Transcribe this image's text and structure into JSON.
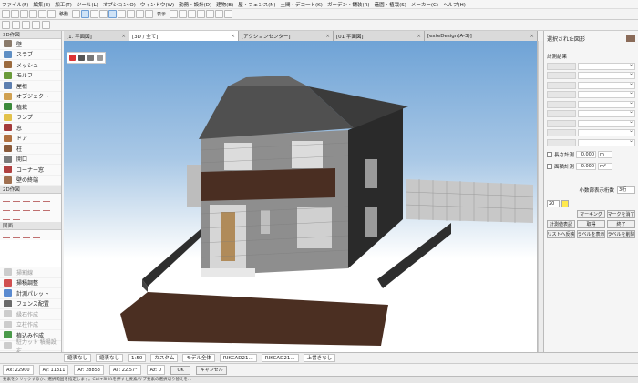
{
  "menu": [
    "ファイル(F)",
    "編集(E)",
    "加工(T)",
    "ツール(L)",
    "オプション(O)",
    "ウィンドウ(W)",
    "勤務・設計(D)",
    "建物(B)",
    "屋・フェンス(N)",
    "土間・デコ一ト(K)",
    "ガーデン・舗装(R)",
    "造園・植栽(S)",
    "メーカー(C)",
    "ヘルプ(H)"
  ],
  "toolbar": {
    "label_a": "移動",
    "label_b": "表示"
  },
  "tabs": [
    {
      "label": "[1. 平面図]"
    },
    {
      "label": "[3D / 全て]"
    },
    {
      "label": "[アクションセンター]"
    },
    {
      "label": "[01 平面図]"
    },
    {
      "label": "[exteDesign(A-3)]"
    }
  ],
  "palette": {
    "section_3d": "3D作図",
    "items_3d": [
      {
        "label": "壁",
        "color": "#8a7a6a"
      },
      {
        "label": "スラブ",
        "color": "#5f8fc4"
      },
      {
        "label": "メッシュ",
        "color": "#9c6b3e"
      },
      {
        "label": "モルフ",
        "color": "#6a9b3a"
      },
      {
        "label": "屋根",
        "color": "#5d7fb0"
      },
      {
        "label": "オブジェクト",
        "color": "#d0a050"
      },
      {
        "label": "植栽",
        "color": "#3b8a3b"
      },
      {
        "label": "ランプ",
        "color": "#e2c14a"
      },
      {
        "label": "窓",
        "color": "#a33a3a"
      },
      {
        "label": "ドア",
        "color": "#b07040"
      },
      {
        "label": "柱",
        "color": "#8a5a3a"
      },
      {
        "label": "開口",
        "color": "#7a7a7a"
      },
      {
        "label": "コーナー窓",
        "color": "#b04040"
      },
      {
        "label": "壁の終端",
        "color": "#a07050"
      }
    ],
    "section_2d": "2D作図",
    "section_fig": "図面",
    "items_bottom": [
      {
        "label": "掃割線",
        "dim": true,
        "color": "#cccccc"
      },
      {
        "label": "掃積調整",
        "dim": false,
        "color": "#d05050"
      },
      {
        "label": "計測パレット",
        "dim": false,
        "color": "#5a8ad0"
      },
      {
        "label": "フェンス配置",
        "dim": false,
        "color": "#6a6a6a"
      },
      {
        "label": "縁石作成",
        "dim": true,
        "color": "#cccccc"
      },
      {
        "label": "立柱作成",
        "dim": true,
        "color": "#cccccc"
      },
      {
        "label": "植込み作成",
        "dim": false,
        "color": "#4a9a4a"
      },
      {
        "label": "駐力ット 積揚設定",
        "dim": true,
        "color": "#cccccc"
      },
      {
        "label": "駐カット 土壁",
        "dim": true,
        "color": "#cccccc"
      }
    ]
  },
  "right_panel": {
    "title": "選択された図形",
    "section": "計測結果",
    "length_label": "長さ計測",
    "length_value": "0.000",
    "length_unit": "m",
    "area_label": "面積計測",
    "area_value": "0.000",
    "area_unit": "m²",
    "decimal_label": "小数部表示桁数",
    "decimal_value": "3桁",
    "slider_value": "20",
    "buttons": [
      "マーキング",
      "マークを消す",
      "計測値表記",
      "取得",
      "終了",
      "リストへ反映",
      "ラベルを表示",
      "ラベルを削除"
    ]
  },
  "bottom_bar": {
    "fields": [
      "縮表なし",
      "縮表なし",
      "1:50",
      "カスタム",
      "モデル全体",
      "RIKCAD21...",
      "RIKCAD21...",
      "上書きなし"
    ]
  },
  "info_bar": {
    "ax": "Ax: 22900",
    "ay": "Ay: 11311",
    "ar": "Ar: 28853",
    "aa": "Aa: 22.57°",
    "az": "Az: 0",
    "ok": "OK",
    "cancel": "キャンセル"
  },
  "status": "要素をクリックするか、選択範囲を指定します。Ctrl+Shiftを押すと要素/サブ要素の選択切り替えを…"
}
